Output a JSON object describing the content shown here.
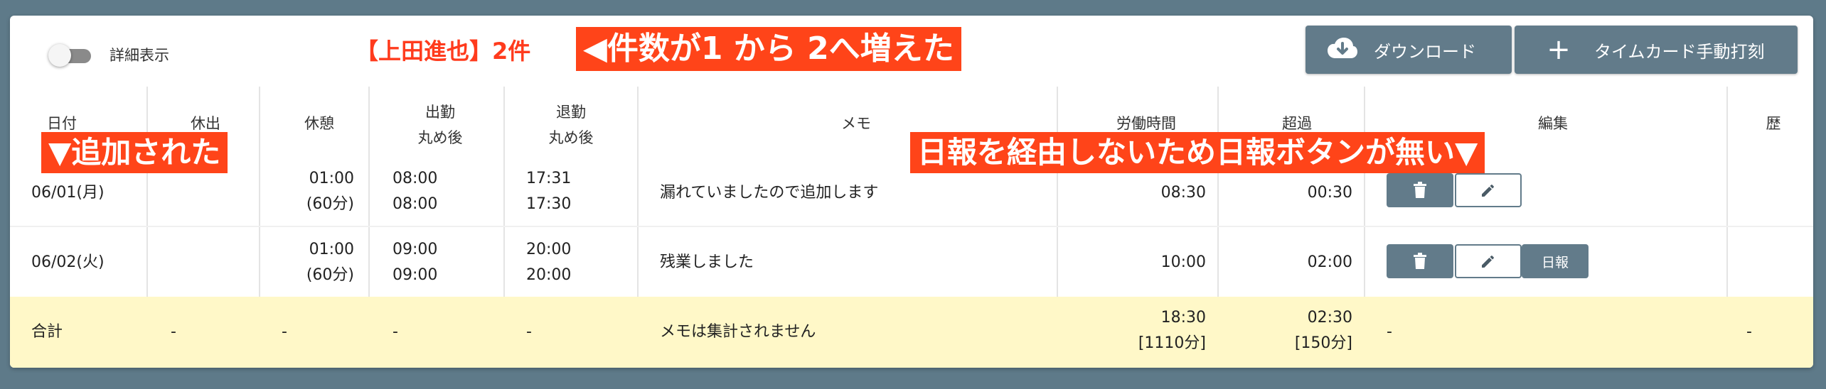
{
  "toolbar": {
    "toggle_label": "詳細表示",
    "count_label": "【上田進也】2件",
    "download_label": "ダウンロード",
    "punch_label": "タイムカード手動打刻",
    "punch_icon": "plus-icon",
    "download_icon": "cloud-download-icon"
  },
  "annotations": {
    "count_changed": "◀件数が1 から 2へ増えた",
    "added": "▼追加された",
    "no_report_button": "日報を経由しないため日報ボタンが無い▼"
  },
  "table": {
    "headers": {
      "date": "日付",
      "holiday": "休出",
      "break": "休憩",
      "in_line1": "出勤",
      "in_line2": "丸め後",
      "out_line1": "退勤",
      "out_line2": "丸め後",
      "memo": "メモ",
      "work": "労働時間",
      "over": "超過",
      "edit": "編集",
      "history": "歴"
    },
    "rows": [
      {
        "date": "06/01(月)",
        "holiday": "",
        "break1": "01:00",
        "break2": "(60分)",
        "in1": "08:00",
        "in2": "08:00",
        "out1": "17:31",
        "out2": "17:30",
        "memo": "漏れていましたので追加します",
        "work": "08:30",
        "over": "00:30",
        "has_report": false
      },
      {
        "date": "06/02(火)",
        "holiday": "",
        "break1": "01:00",
        "break2": "(60分)",
        "in1": "09:00",
        "in2": "09:00",
        "out1": "20:00",
        "out2": "20:00",
        "memo": "残業しました",
        "work": "10:00",
        "over": "02:00",
        "has_report": true,
        "report_label": "日報"
      }
    ],
    "total": {
      "label": "合計",
      "holiday": "-",
      "break": "-",
      "in": "-",
      "out": "-",
      "memo": "メモは集計されません",
      "work1": "18:30",
      "work2": "[1110分]",
      "over1": "02:30",
      "over2": "[150分]",
      "edit": "-",
      "history": "-"
    }
  },
  "colors": {
    "accent": "#627b8a",
    "callout": "#ff4419",
    "total_bg": "#fff8c8",
    "background": "#5e7a89"
  }
}
